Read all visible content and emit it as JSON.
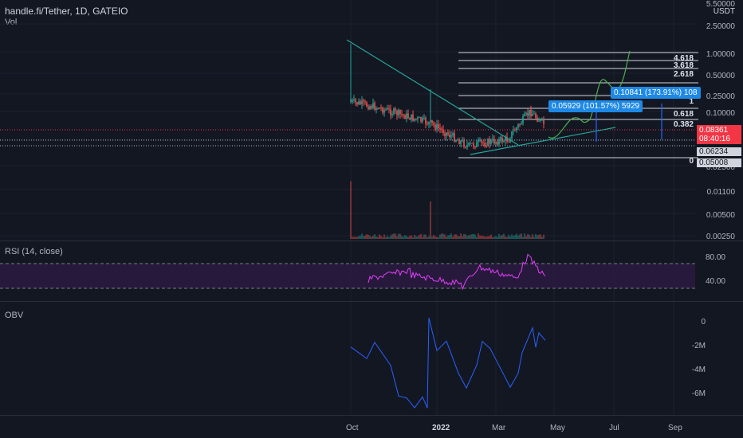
{
  "header": {
    "symbol_line": "handle.fi/Tether, 1D, GATEIO",
    "volume_label": "Vol"
  },
  "price_axis": {
    "currency_tag": "USDT",
    "ticks": [
      "5.50000",
      "2.50000",
      "1.00000",
      "0.50000",
      "0.25000",
      "0.10000",
      "0.02500",
      "0.01100",
      "0.00500",
      "0.00250"
    ]
  },
  "price_tags": {
    "last_price": "0.08361",
    "countdown": "08:40:16",
    "level_a": "0.06234",
    "level_b": "0.05008"
  },
  "fib_levels": [
    "4.618",
    "3.618",
    "2.618",
    "1",
    "0.618",
    "0.382",
    "0"
  ],
  "measures": [
    {
      "text": "0.10841 (173.91%) 108"
    },
    {
      "text": "0.05929 (101.57%) 5929"
    }
  ],
  "rsi": {
    "label": "RSI (14, close)",
    "ticks": [
      "80.00",
      "40.00"
    ]
  },
  "obv": {
    "label": "OBV",
    "ticks": [
      "0",
      "-2M",
      "-4M",
      "-6M"
    ]
  },
  "time_axis": {
    "labels": [
      "Oct",
      "2022",
      "Mar",
      "May",
      "Jul",
      "Sep"
    ]
  },
  "colors": {
    "background": "#131722",
    "up": "#26a69a",
    "down": "#ef5350",
    "rsi_line": "#e040fb",
    "rsi_band": "#2a1a3e",
    "obv_line": "#2962ff",
    "trendline": "#26a69a",
    "last_price_tag": "#f23645"
  }
}
